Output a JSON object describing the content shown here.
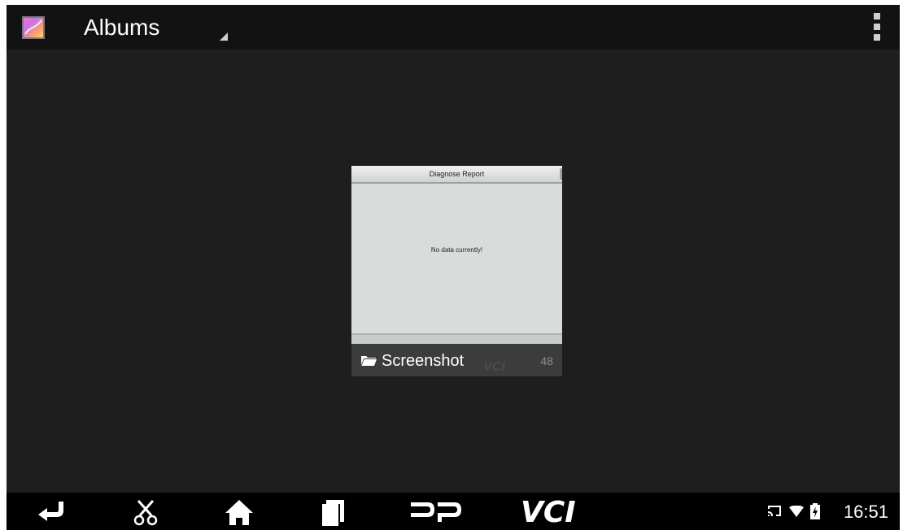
{
  "action_bar": {
    "title": "Albums"
  },
  "album": {
    "name": "Screenshot",
    "count": "48",
    "thumbnail": {
      "header": "Diagnose Report",
      "body": "No data currently!"
    }
  },
  "nav_bar": {
    "buttons": [
      "back-icon",
      "scissors-icon",
      "home-icon",
      "recent-apps-icon",
      "dp-icon",
      "vci-icon"
    ],
    "vci_label": "VCI"
  },
  "status": {
    "icons": [
      "cast-icon",
      "wifi-icon",
      "battery-charging-icon"
    ],
    "time": "16:51"
  },
  "colors": {
    "screen_bg": "#1e1e1e",
    "action_bar_bg": "#121212",
    "nav_bar_bg": "#000000",
    "text": "#ffffff"
  }
}
